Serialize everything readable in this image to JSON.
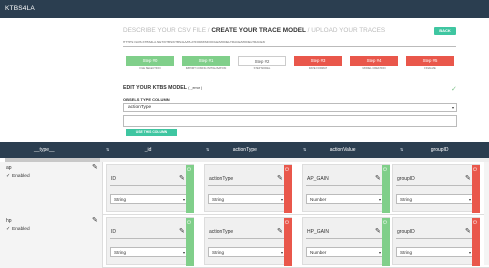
{
  "app": {
    "title": "KTBS4LA"
  },
  "wizard": {
    "heading_prefix": "DESCRIBE YOUR CSV FILE / ",
    "heading_current": "CREATE YOUR TRACE MODEL",
    "heading_suffix": " / UPLOAD YOUR TRACES",
    "back_label": "BACK",
    "url": "HTTPS://LRS.KTBS4LA.NET/KTBS/KTBS4LA/PLATFORM/MOODLE/MODELTRACE/MODELTRACE3/",
    "steps": [
      {
        "label": "Step #0",
        "sub": "FILE SELECTION",
        "state": "done"
      },
      {
        "label": "Step #1",
        "sub": "IMPORT CONFIG INITIALISATION",
        "state": "done"
      },
      {
        "label": "Step #2",
        "sub": "STEP MODEL",
        "state": "current"
      },
      {
        "label": "Step #3",
        "sub": "DATE FORMAT",
        "state": "todo"
      },
      {
        "label": "Step #4",
        "sub": "MODEL CREATION",
        "state": "todo"
      },
      {
        "label": "Step #5",
        "sub": "FINALIZE",
        "state": "todo"
      }
    ]
  },
  "model": {
    "title": "EDIT YOUR KTBS MODEL",
    "title_small": "( _error )",
    "obsel_label": "OBSELS TYPE COLUMN",
    "obsel_value": "actionType",
    "use_button": "USE THIS COLUMN",
    "colors": {
      "green": "#80cf8a",
      "red": "#e9574b",
      "accent": "#3fc6a1",
      "dark": "#2b3e50"
    }
  },
  "table": {
    "headers": [
      "__type__",
      "_id",
      "actionType",
      "actionValue",
      "groupID"
    ],
    "rows": [
      {
        "type": "ap",
        "enabled_label": "Enabled",
        "fields": [
          {
            "name": "ID",
            "type": "String",
            "flag": "green"
          },
          {
            "name": "actionType",
            "type": "String",
            "flag": "red"
          },
          {
            "name": "AP_GAIN",
            "type": "Number",
            "flag": "green"
          },
          {
            "name": "groupID",
            "type": "String",
            "flag": "red"
          }
        ]
      },
      {
        "type": "hp",
        "enabled_label": "Enabled",
        "fields": [
          {
            "name": "ID",
            "type": "String",
            "flag": "green"
          },
          {
            "name": "actionType",
            "type": "String",
            "flag": "red"
          },
          {
            "name": "HP_GAIN",
            "type": "Number",
            "flag": "green"
          },
          {
            "name": "groupID",
            "type": "String",
            "flag": "red"
          }
        ]
      }
    ]
  }
}
